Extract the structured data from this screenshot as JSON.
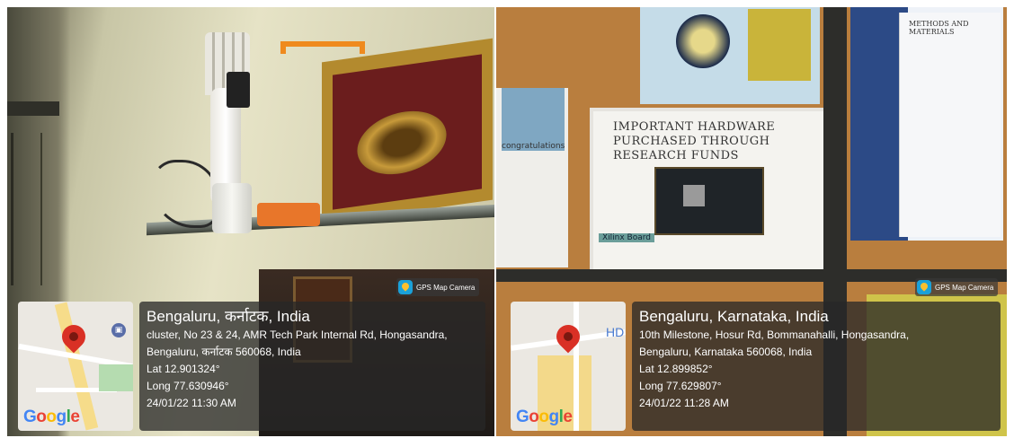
{
  "panels": [
    {
      "badge": "GPS Map Camera",
      "location": "Bengaluru, कर्नाटक, India",
      "address_line1": "cluster, No 23 & 24, AMR Tech Park Internal Rd, Hongasandra,",
      "address_line2": "Bengaluru, कर्नाटक 560068, India",
      "lat": "Lat 12.901324°",
      "long": "Long 77.630946°",
      "datetime": "24/01/22 11:30 AM",
      "map_logo": "Google"
    },
    {
      "badge": "GPS Map Camera",
      "location": "Bengaluru, Karnataka, India",
      "address_line1": "10th Milestone, Hosur Rd, Bommanahalli, Hongasandra,",
      "address_line2": "Bengaluru, Karnataka 560068, India",
      "lat": "Lat 12.899852°",
      "long": "Long 77.629807°",
      "datetime": "24/01/22 11:28 AM",
      "map_logo": "Google",
      "map_poi_text": "HD"
    }
  ],
  "right_scene": {
    "poster_title": "IMPORTANT HARDWARE PURCHASED THROUGH RESEARCH FUNDS",
    "board_caption": "Xilinx Board",
    "left_poster_heading": "congratulations",
    "right_poster_heading": "METHODS AND MATERIALS"
  }
}
